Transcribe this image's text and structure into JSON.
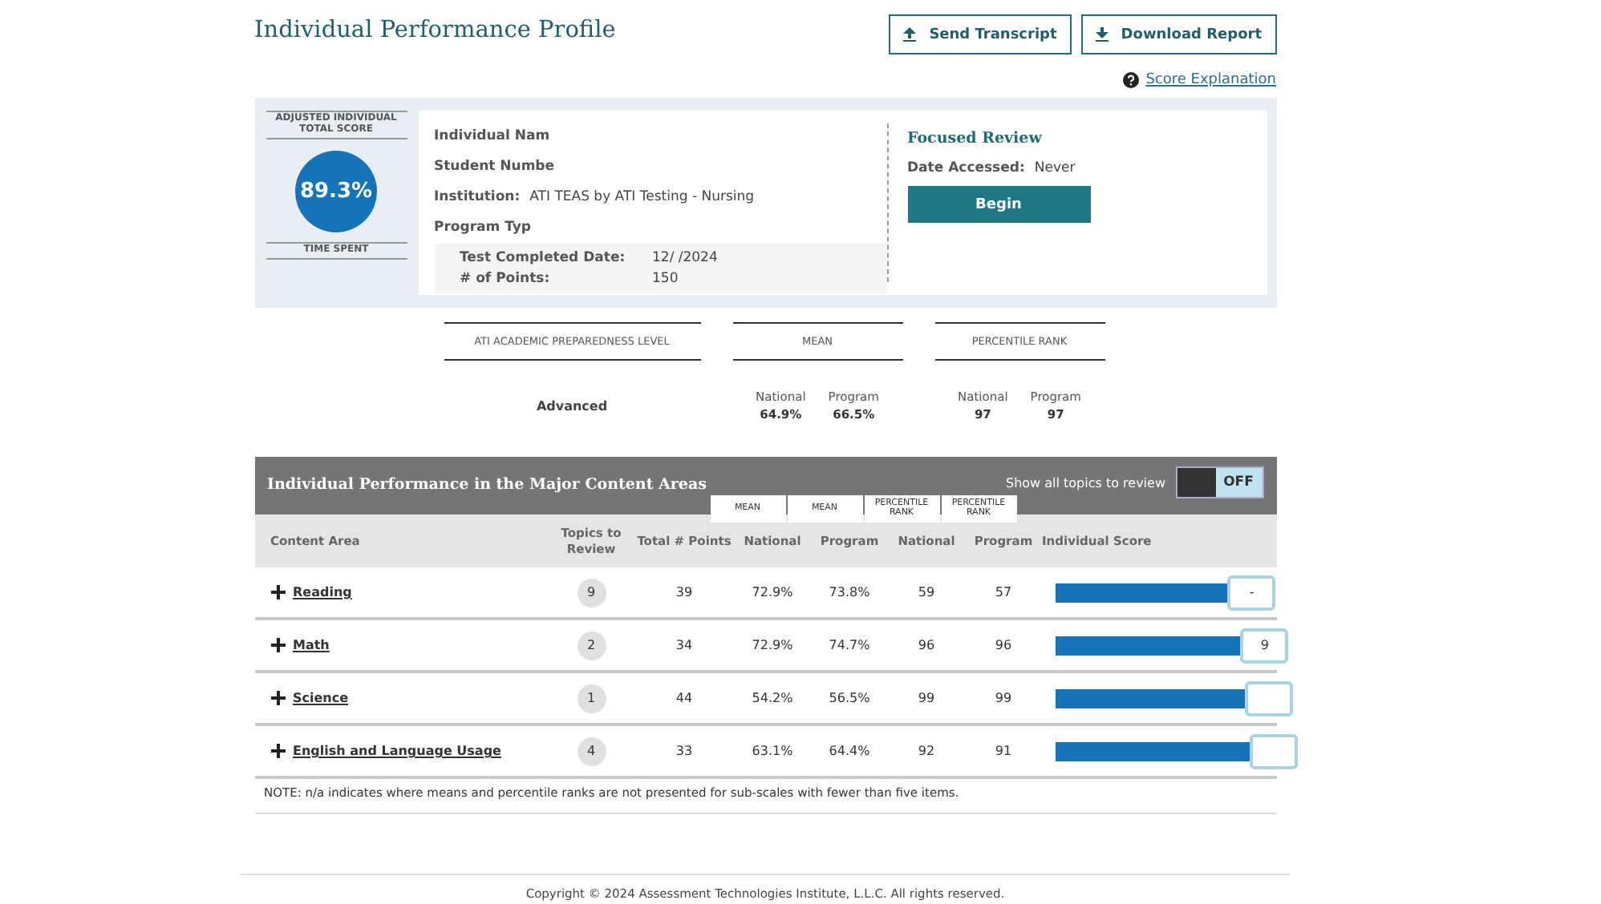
{
  "page_title": "Individual Performance Profile",
  "actions": [
    {
      "label": "Send Transcript",
      "kind": "upload"
    },
    {
      "label": "Download Report",
      "kind": "download"
    }
  ],
  "help_link": "Score Explanation",
  "score_card": {
    "label": "ADJUSTED INDIVIDUAL TOTAL SCORE",
    "score": "89.3%",
    "time_label": "TIME SPENT"
  },
  "details": [
    {
      "label": "Individual Nam"
    },
    {
      "label": "Student Numbe"
    },
    {
      "label": "Institution:",
      "value": "ATI TEAS by ATI Testing - Nursing"
    },
    {
      "label": "Program Typ"
    }
  ],
  "test_info": [
    {
      "label": "Test Completed Date:",
      "value": "12/ /2024"
    },
    {
      "label": "# of Points:",
      "value": "150"
    }
  ],
  "focused_review": {
    "title": "Focused Review",
    "date_label": "Date Accessed:",
    "date_value": "Never",
    "button": "Begin"
  },
  "summary": {
    "level_heading": "ATI ACADEMIC PREPAREDNESS LEVEL",
    "level": "Advanced",
    "groups": [
      {
        "heading": "MEAN",
        "cols": [
          {
            "label": "National",
            "value": "64.9%"
          },
          {
            "label": "Program",
            "value": "66.5%"
          }
        ]
      },
      {
        "heading": "PERCENTILE RANK",
        "cols": [
          {
            "label": "National",
            "value": "97"
          },
          {
            "label": "Program",
            "value": "97"
          }
        ]
      }
    ]
  },
  "table": {
    "title": "Individual Performance in the Major Content Areas",
    "toggle": {
      "label": "Show all topics to review",
      "on": false,
      "state_text": "OFF"
    },
    "top_tags": [
      "MEAN",
      "MEAN",
      "PERCENTILE RANK",
      "PERCENTILE RANK"
    ],
    "columns": [
      "Content Area",
      "Topics to Review",
      "Total # Points",
      "National",
      "Program",
      "National",
      "Program",
      "Individual Score"
    ],
    "rows": [
      {
        "area": "Reading",
        "topics": "9",
        "points": "39",
        "mean_national": "72.9%",
        "mean_program": "73.8%",
        "pr_national": "59",
        "pr_program": "57",
        "level": 0.82,
        "bubble": "-"
      },
      {
        "area": "Math",
        "topics": "2",
        "points": "34",
        "mean_national": "72.9%",
        "mean_program": "74.7%",
        "pr_national": "96",
        "pr_program": "96",
        "level": 0.88,
        "bubble": "9"
      },
      {
        "area": "Science",
        "topics": "1",
        "points": "44",
        "mean_national": "54.2%",
        "mean_program": "56.5%",
        "pr_national": "99",
        "pr_program": "99",
        "level": 0.9
      },
      {
        "area": "English and Language Usage",
        "topics": "4",
        "points": "33",
        "mean_national": "63.1%",
        "mean_program": "64.4%",
        "pr_national": "92",
        "pr_program": "91",
        "level": 0.92
      }
    ],
    "note": "NOTE: n/a indicates where means and percentile ranks are not presented for sub-scales with fewer than five items."
  },
  "footer": "Copyright © 2024 Assessment Technologies Institute, L.L.C. All rights reserved."
}
